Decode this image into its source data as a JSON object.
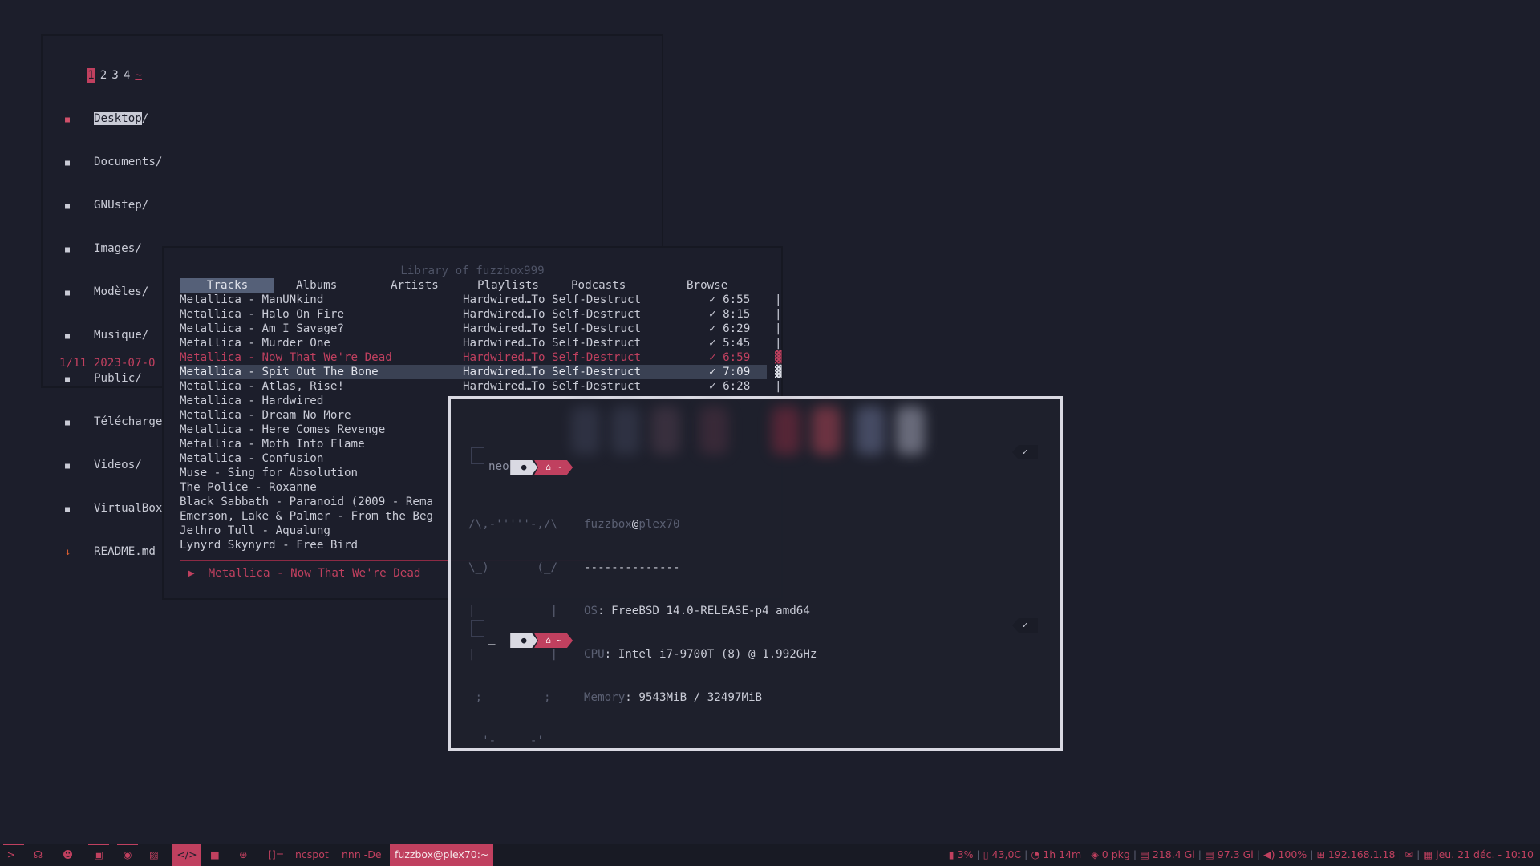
{
  "nnn": {
    "tabs": [
      "1",
      "2",
      "3",
      "4"
    ],
    "home_tab": "~",
    "entries": [
      {
        "name": "Desktop",
        "suffix": "/",
        "icon": "lock-icon"
      },
      {
        "name": "Documents/",
        "icon": "folder-icon"
      },
      {
        "name": "GNUstep/",
        "icon": "folder-icon"
      },
      {
        "name": "Images/",
        "icon": "folder-icon"
      },
      {
        "name": "Modèles/",
        "icon": "folder-icon"
      },
      {
        "name": "Musique/",
        "icon": "folder-icon"
      },
      {
        "name": "Public/",
        "icon": "folder-icon"
      },
      {
        "name": "Téléchargements/",
        "icon": "folder-icon"
      },
      {
        "name": "Videos/",
        "icon": "folder-icon"
      },
      {
        "name": "VirtualBox VMs/",
        "icon": "folder-icon"
      },
      {
        "name": "README.md",
        "icon": "markdown-icon"
      }
    ],
    "status": "1/11 2023-07-0"
  },
  "ncspot": {
    "title": "Library of fuzzbox999",
    "tabs": [
      "Tracks",
      "Albums",
      "Artists",
      "Playlists",
      "Podcasts",
      "Browse"
    ],
    "tracks": [
      {
        "title": "Metallica - ManUNkind",
        "album": "Hardwired…To Self-Destruct",
        "dur": "✓ 6:55",
        "bar": "|"
      },
      {
        "title": "Metallica - Halo On Fire",
        "album": "Hardwired…To Self-Destruct",
        "dur": "✓ 8:15",
        "bar": "|"
      },
      {
        "title": "Metallica - Am I Savage?",
        "album": "Hardwired…To Self-Destruct",
        "dur": "✓ 6:29",
        "bar": "|"
      },
      {
        "title": "Metallica - Murder One",
        "album": "Hardwired…To Self-Destruct",
        "dur": "✓ 5:45",
        "bar": "|"
      },
      {
        "title": "Metallica - Now That We're Dead",
        "album": "Hardwired…To Self-Destruct",
        "dur": "✓ 6:59",
        "bar": "▓"
      },
      {
        "title": "Metallica - Spit Out The Bone",
        "album": "Hardwired…To Self-Destruct",
        "dur": "✓ 7:09",
        "bar": "▓"
      },
      {
        "title": "Metallica - Atlas, Rise!",
        "album": "Hardwired…To Self-Destruct",
        "dur": "✓ 6:28",
        "bar": "|"
      },
      {
        "title": "Metallica - Hardwired",
        "album": "",
        "dur": "",
        "bar": ""
      },
      {
        "title": "Metallica - Dream No More",
        "album": "",
        "dur": "",
        "bar": ""
      },
      {
        "title": "Metallica - Here Comes Revenge",
        "album": "",
        "dur": "",
        "bar": ""
      },
      {
        "title": "Metallica - Moth Into Flame",
        "album": "",
        "dur": "",
        "bar": ""
      },
      {
        "title": "Metallica - Confusion",
        "album": "",
        "dur": "",
        "bar": ""
      },
      {
        "title": "Muse - Sing for Absolution",
        "album": "",
        "dur": "",
        "bar": ""
      },
      {
        "title": "The Police - Roxanne",
        "album": "",
        "dur": "",
        "bar": ""
      },
      {
        "title": "Black Sabbath - Paranoid (2009 - Rema",
        "album": "",
        "dur": "",
        "bar": ""
      },
      {
        "title": "Emerson, Lake & Palmer - From the Beg",
        "album": "",
        "dur": "",
        "bar": ""
      },
      {
        "title": "Jethro Tull - Aqualung",
        "album": "",
        "dur": "",
        "bar": ""
      },
      {
        "title": "Lynyrd Skynyrd - Free Bird",
        "album": "",
        "dur": "",
        "bar": ""
      }
    ],
    "playing_index": 4,
    "selected_index": 5,
    "now_playing": "▶  Metallica - Now That We're Dead"
  },
  "terminal": {
    "prompt_home": "~",
    "prompt_check": "✓",
    "command": "neo",
    "ascii_art": [
      "/\\,-'''''-,/\\",
      "\\_)       (_/",
      "|           |",
      "|           |",
      " ;         ;",
      "  '-_____-'"
    ],
    "user": "fuzzbox",
    "at": "@",
    "host": "plex70",
    "separator": "--------------",
    "info": [
      {
        "key": "OS",
        "value": ": FreeBSD 14.0-RELEASE-p4 amd64"
      },
      {
        "key": "CPU",
        "value": ": Intel i7-9700T (8) @ 1.992GHz"
      },
      {
        "key": "Memory",
        "value": ": 9543MiB / 32497MiB"
      }
    ],
    "cursor": "_"
  },
  "taskbar": {
    "left_icons": [
      "terminal-icon",
      "headphones-icon",
      "user-icon",
      "briefcase-icon",
      "firefox-icon",
      "image-icon",
      "code-icon",
      "video-icon",
      "gamepad-icon"
    ],
    "layout": "[]=",
    "windows": [
      "ncspot",
      "nnn -De",
      "fuzzbox@plex70:~"
    ],
    "status": {
      "cpu": "3%",
      "temp": "43,0C",
      "uptime": "1h 14m",
      "pkg": "0 pkg",
      "disk1": "218.4 Gi",
      "disk2": "97.3 Gi",
      "volume": "100%",
      "ip": "192.168.1.18",
      "datetime": "jeu. 21 déc. - 10:10"
    }
  }
}
